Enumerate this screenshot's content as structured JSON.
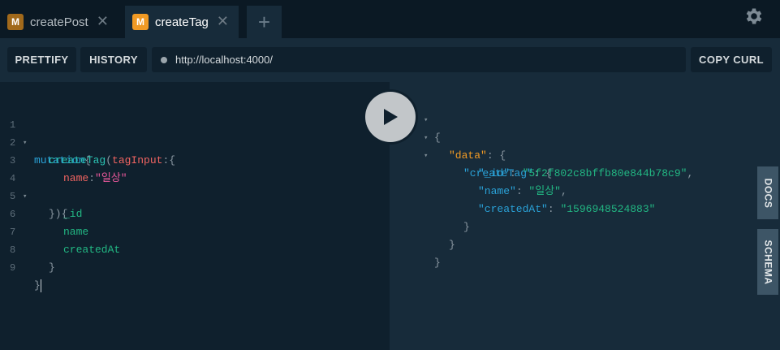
{
  "tabs": [
    {
      "badge": "M",
      "label": "createPost",
      "close": "✕"
    },
    {
      "badge": "M",
      "label": "createTag",
      "close": "✕"
    }
  ],
  "add_tab": "+",
  "toolbar": {
    "prettify": "PRETTIFY",
    "history": "HISTORY",
    "url": "http://localhost:4000/",
    "copy_curl": "COPY CURL"
  },
  "editor": {
    "line_numbers": [
      "1",
      "2",
      "3",
      "4",
      "5",
      "6",
      "7",
      "8",
      "9"
    ],
    "tokens": {
      "mutation": "mutation",
      "open_brace": "{",
      "createTag": "createTag",
      "paren_open": "(",
      "tagInput": "tagInput",
      "colon_brace": ":{",
      "name_arg": "name",
      "colon": ":",
      "name_value": "\"일상\"",
      "close_args": "}){",
      "field_id": "_id",
      "field_name": "name",
      "field_createdAt": "createdAt",
      "close_inner": "}",
      "close_outer": "}"
    }
  },
  "result": {
    "open": "{",
    "data_key": "\"data\"",
    "create_key": "\"createTag\"",
    "id_key": "\"_id\"",
    "id_value": "\"5f2f802c8bffb80e844b78c9\"",
    "name_key": "\"name\"",
    "name_value": "\"일상\"",
    "created_key": "\"createdAt\"",
    "created_value": "\"1596948524883\"",
    "colon_brace": ": {",
    "colon": ": ",
    "comma": ",",
    "close": "}"
  },
  "side_tabs": {
    "docs": "DOCS",
    "schema": "SCHEMA"
  },
  "icons": {
    "settings": "gear-icon",
    "run": "play-icon"
  },
  "colors": {
    "accent": "#f19a24",
    "keyword": "#2aa2d8",
    "string": "#e8589a",
    "field": "#22b783"
  }
}
